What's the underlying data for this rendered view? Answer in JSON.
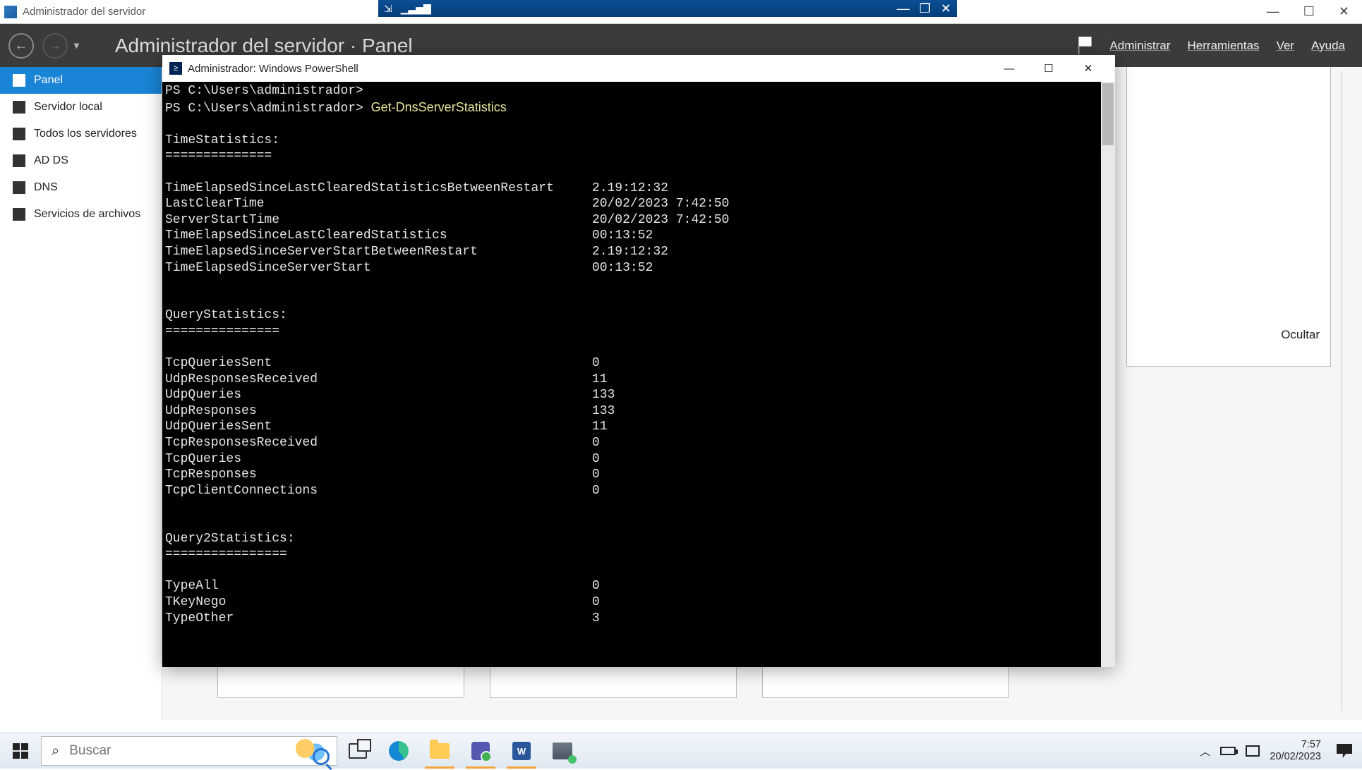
{
  "serverManager": {
    "title": "Administrador del servidor",
    "breadcrumb": "Administrador del servidor · Panel",
    "menus": [
      "Administrar",
      "Herramientas",
      "Ver",
      "Ayuda"
    ],
    "sidebar": [
      {
        "label": "Panel"
      },
      {
        "label": "Servidor local"
      },
      {
        "label": "Todos los servidores"
      },
      {
        "label": "AD DS"
      },
      {
        "label": "DNS"
      },
      {
        "label": "Servicios de archivos"
      }
    ],
    "hideLink": "Ocultar"
  },
  "powershell": {
    "title": "Administrador: Windows PowerShell",
    "promptPath": "PS C:\\Users\\administrador>",
    "command": "Get-DnsServerStatistics",
    "sections": {
      "time": {
        "header": "TimeStatistics:",
        "underline": "==============",
        "rows": [
          [
            "TimeElapsedSinceLastClearedStatisticsBetweenRestart",
            "2.19:12:32"
          ],
          [
            "LastClearTime",
            "20/02/2023 7:42:50"
          ],
          [
            "ServerStartTime",
            "20/02/2023 7:42:50"
          ],
          [
            "TimeElapsedSinceLastClearedStatistics",
            "00:13:52"
          ],
          [
            "TimeElapsedSinceServerStartBetweenRestart",
            "2.19:12:32"
          ],
          [
            "TimeElapsedSinceServerStart",
            "00:13:52"
          ]
        ]
      },
      "query": {
        "header": "QueryStatistics:",
        "underline": "===============",
        "rows": [
          [
            "TcpQueriesSent",
            "0"
          ],
          [
            "UdpResponsesReceived",
            "11"
          ],
          [
            "UdpQueries",
            "133"
          ],
          [
            "UdpResponses",
            "133"
          ],
          [
            "UdpQueriesSent",
            "11"
          ],
          [
            "TcpResponsesReceived",
            "0"
          ],
          [
            "TcpQueries",
            "0"
          ],
          [
            "TcpResponses",
            "0"
          ],
          [
            "TcpClientConnections",
            "0"
          ]
        ]
      },
      "query2": {
        "header": "Query2Statistics:",
        "underline": "================",
        "rows": [
          [
            "TypeAll",
            "0"
          ],
          [
            "TKeyNego",
            "0"
          ],
          [
            "TypeOther",
            "3"
          ]
        ]
      }
    }
  },
  "taskbar": {
    "searchPlaceholder": "Buscar",
    "clockTime": "7:57",
    "clockDate": "20/02/2023"
  },
  "windowControls": {
    "min": "—",
    "max": "☐",
    "close": "✕"
  }
}
